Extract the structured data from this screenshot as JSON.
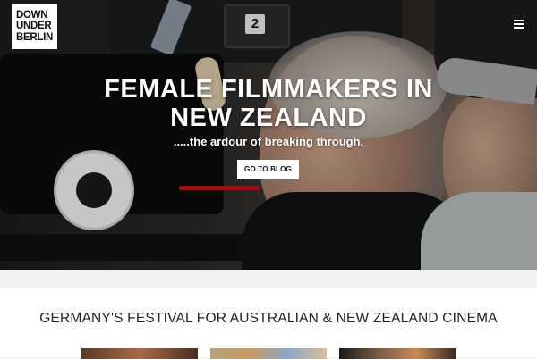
{
  "logo": {
    "line1": "DOWN",
    "line2": "UNDER",
    "line3": "BERLIN"
  },
  "nav": {
    "menu_icon": "hamburger-menu-icon"
  },
  "hero": {
    "title_line1": "FEMALE FILMMAKERS IN",
    "title_line2": "NEW ZEALAND",
    "subtitle": ".....the ardour of breaking through.",
    "button_label": "GO TO BLOG",
    "camera_plate_number": "2",
    "image_description_icon": "film-camera-photo"
  },
  "festival": {
    "heading": "GERMANY'S FESTIVAL FOR AUSTRALIAN & NEW ZEALAND CINEMA"
  },
  "colors": {
    "button_bg": "#ffffff",
    "heading_text": "#222222",
    "hero_text": "#ffffff"
  }
}
